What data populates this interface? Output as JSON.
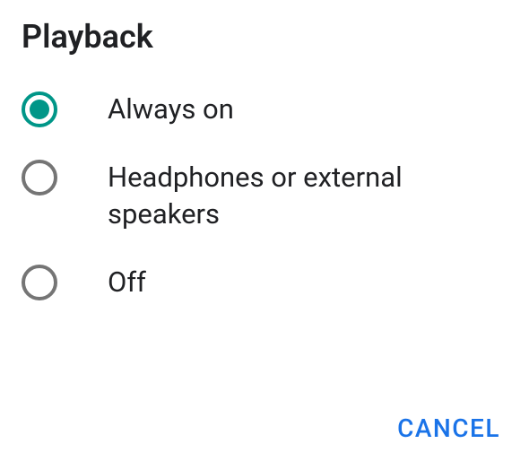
{
  "title": "Playback",
  "options": [
    {
      "label": "Always on",
      "selected": true
    },
    {
      "label": "Headphones or external speakers",
      "selected": false
    },
    {
      "label": "Off",
      "selected": false
    }
  ],
  "footer": {
    "cancel": "CANCEL"
  },
  "colors": {
    "accent": "#009688",
    "primary_action": "#1a73e8"
  }
}
